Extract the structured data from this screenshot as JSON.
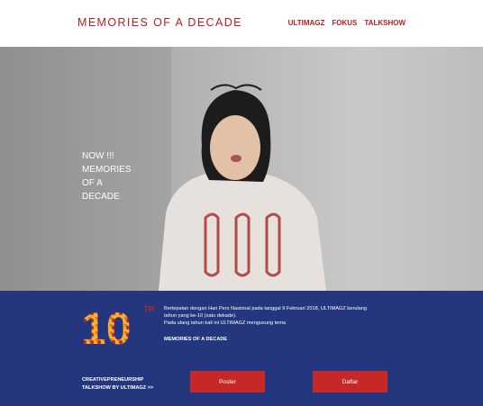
{
  "header": {
    "title": "MEMORIES OF A DECADE",
    "nav": [
      "ULTIMAGZ",
      "FOKUS",
      "TALKSHOW"
    ]
  },
  "hero": {
    "lines": [
      "NOW !!!",
      "MEMORIES",
      "OF A",
      "DECADE"
    ]
  },
  "intro": {
    "logo_number": "10",
    "logo_suffix": "TH",
    "paragraph_lines": [
      "Bertepatan dengan Hari Pers Nasional pada tanggal 9 Februari 2018, ULTIMAGZ berulang",
      "tahun yang ke-10 (satu dekade).",
      "Pada ulang tahun kali ini ULTIMAGZ mengusung tema"
    ],
    "theme": "MEMORIES OF A DECADE"
  },
  "event": {
    "lines": [
      "CREATIVEPRENEURSHIP",
      "TALKSHOW BY ULTIMAGZ >>"
    ],
    "poster_label": "Poster",
    "register_label": "Daftar"
  },
  "colors": {
    "accent": "#b22222",
    "band": "#24367d",
    "button": "#c62828",
    "logo_gold": "#f2b233"
  }
}
